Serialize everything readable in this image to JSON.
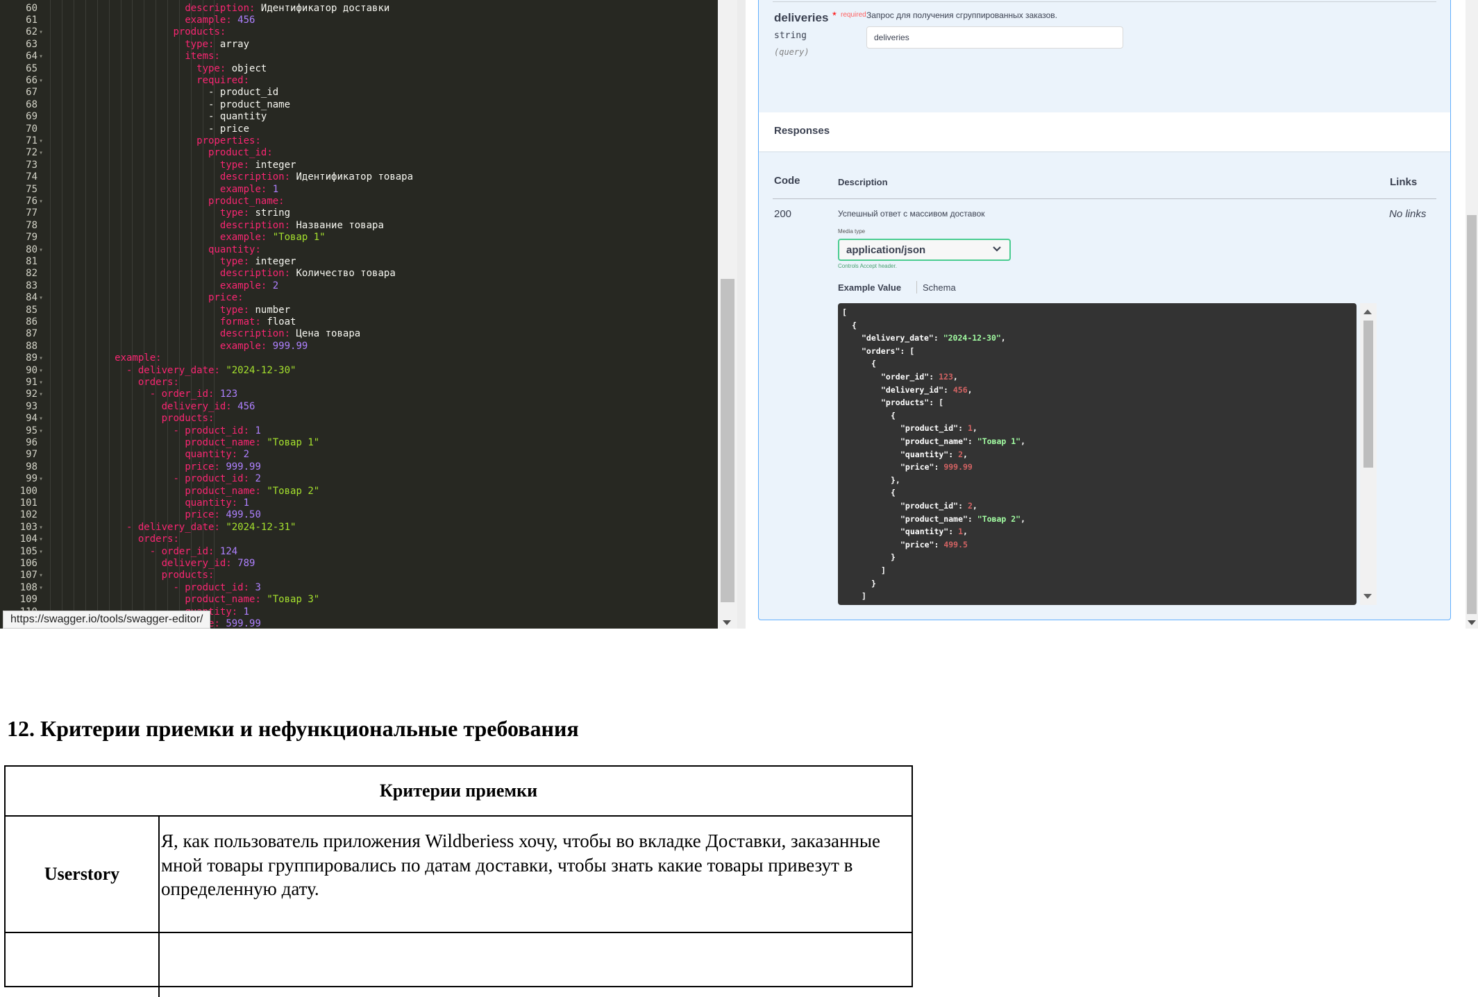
{
  "editor": {
    "first_line": 60,
    "lines": [
      [
        [
          12,
          "d",
          "description: "
        ],
        [
          0,
          "t",
          "Идентификатор доставки"
        ]
      ],
      [
        [
          12,
          "d",
          "example: "
        ],
        [
          0,
          "n",
          "456"
        ]
      ],
      [
        [
          11,
          "k",
          "products:"
        ]
      ],
      [
        [
          12,
          "d",
          "type: "
        ],
        [
          0,
          "t",
          "array"
        ]
      ],
      [
        [
          12,
          "k",
          "items:"
        ]
      ],
      [
        [
          13,
          "d",
          "type: "
        ],
        [
          0,
          "t",
          "object"
        ]
      ],
      [
        [
          13,
          "k",
          "required:"
        ]
      ],
      [
        [
          14,
          "t",
          "- product_id"
        ]
      ],
      [
        [
          14,
          "t",
          "- product_name"
        ]
      ],
      [
        [
          14,
          "t",
          "- quantity"
        ]
      ],
      [
        [
          14,
          "t",
          "- price"
        ]
      ],
      [
        [
          13,
          "k",
          "properties:"
        ]
      ],
      [
        [
          14,
          "k",
          "product_id:"
        ]
      ],
      [
        [
          15,
          "d",
          "type: "
        ],
        [
          0,
          "t",
          "integer"
        ]
      ],
      [
        [
          15,
          "d",
          "description: "
        ],
        [
          0,
          "t",
          "Идентификатор товара"
        ]
      ],
      [
        [
          15,
          "d",
          "example: "
        ],
        [
          0,
          "n",
          "1"
        ]
      ],
      [
        [
          14,
          "k",
          "product_name:"
        ]
      ],
      [
        [
          15,
          "d",
          "type: "
        ],
        [
          0,
          "t",
          "string"
        ]
      ],
      [
        [
          15,
          "d",
          "description: "
        ],
        [
          0,
          "t",
          "Название товара"
        ]
      ],
      [
        [
          15,
          "d",
          "example: "
        ],
        [
          0,
          "s",
          "\"Товар 1\""
        ]
      ],
      [
        [
          14,
          "k",
          "quantity:"
        ]
      ],
      [
        [
          15,
          "d",
          "type: "
        ],
        [
          0,
          "t",
          "integer"
        ]
      ],
      [
        [
          15,
          "d",
          "description: "
        ],
        [
          0,
          "t",
          "Количество товара"
        ]
      ],
      [
        [
          15,
          "d",
          "example: "
        ],
        [
          0,
          "n",
          "2"
        ]
      ],
      [
        [
          14,
          "k",
          "price:"
        ]
      ],
      [
        [
          15,
          "d",
          "type: "
        ],
        [
          0,
          "t",
          "number"
        ]
      ],
      [
        [
          15,
          "d",
          "format: "
        ],
        [
          0,
          "t",
          "float"
        ]
      ],
      [
        [
          15,
          "d",
          "description: "
        ],
        [
          0,
          "t",
          "Цена товара"
        ]
      ],
      [
        [
          15,
          "d",
          "example: "
        ],
        [
          0,
          "n",
          "999.99"
        ]
      ],
      [
        [
          6,
          "k",
          "example:"
        ]
      ],
      [
        [
          7,
          "k",
          "- delivery_date: "
        ],
        [
          0,
          "s",
          "\"2024-12-30\""
        ]
      ],
      [
        [
          8,
          "k",
          "orders:"
        ]
      ],
      [
        [
          9,
          "k",
          "- order_id: "
        ],
        [
          0,
          "n",
          "123"
        ]
      ],
      [
        [
          10,
          "k",
          "delivery_id: "
        ],
        [
          0,
          "n",
          "456"
        ]
      ],
      [
        [
          10,
          "k",
          "products:"
        ]
      ],
      [
        [
          11,
          "k",
          "- product_id: "
        ],
        [
          0,
          "n",
          "1"
        ]
      ],
      [
        [
          12,
          "k",
          "product_name: "
        ],
        [
          0,
          "s",
          "\"Товар 1\""
        ]
      ],
      [
        [
          12,
          "k",
          "quantity: "
        ],
        [
          0,
          "n",
          "2"
        ]
      ],
      [
        [
          12,
          "k",
          "price: "
        ],
        [
          0,
          "n",
          "999.99"
        ]
      ],
      [
        [
          11,
          "k",
          "- product_id: "
        ],
        [
          0,
          "n",
          "2"
        ]
      ],
      [
        [
          12,
          "k",
          "product_name: "
        ],
        [
          0,
          "s",
          "\"Товар 2\""
        ]
      ],
      [
        [
          12,
          "k",
          "quantity: "
        ],
        [
          0,
          "n",
          "1"
        ]
      ],
      [
        [
          12,
          "k",
          "price: "
        ],
        [
          0,
          "n",
          "499.50"
        ]
      ],
      [
        [
          7,
          "k",
          "- delivery_date: "
        ],
        [
          0,
          "s",
          "\"2024-12-31\""
        ]
      ],
      [
        [
          8,
          "k",
          "orders:"
        ]
      ],
      [
        [
          9,
          "k",
          "- order_id: "
        ],
        [
          0,
          "n",
          "124"
        ]
      ],
      [
        [
          10,
          "k",
          "delivery_id: "
        ],
        [
          0,
          "n",
          "789"
        ]
      ],
      [
        [
          10,
          "k",
          "products:"
        ]
      ],
      [
        [
          11,
          "k",
          "- product_id: "
        ],
        [
          0,
          "n",
          "3"
        ]
      ],
      [
        [
          12,
          "k",
          "product_name: "
        ],
        [
          0,
          "s",
          "\"Товар 3\""
        ]
      ],
      [
        [
          12,
          "k",
          "quantity: "
        ],
        [
          0,
          "n",
          "1"
        ]
      ],
      [
        [
          12,
          "k",
          "price: "
        ],
        [
          0,
          "n",
          "599.99"
        ]
      ]
    ],
    "fold_lines": [
      62,
      64,
      66,
      71,
      72,
      76,
      80,
      84,
      89,
      90,
      91,
      92,
      94,
      95,
      99,
      103,
      104,
      105,
      107,
      108
    ],
    "url_tooltip": "https://swagger.io/tools/swagger-editor/"
  },
  "swagger": {
    "param": {
      "name": "deliveries",
      "required_star": "*",
      "required_label": "required",
      "type": "string",
      "in": "(query)",
      "description": "Запрос для получения сгруппированных заказов.",
      "input_value": "deliveries"
    },
    "responses_title": "Responses",
    "headers": {
      "code": "Code",
      "description": "Description",
      "links": "Links"
    },
    "response": {
      "code": "200",
      "description": "Успешный ответ с массивом доставок",
      "links": "No links",
      "media_type_label": "Media type",
      "media_type": "application/json",
      "controls_hint": "Controls Accept header."
    },
    "tabs": {
      "example": "Example Value",
      "schema": "Schema"
    },
    "example_json": [
      [
        [
          0,
          "p",
          "["
        ]
      ],
      [
        [
          1,
          "p",
          "{"
        ]
      ],
      [
        [
          2,
          "k",
          "\"delivery_date\": "
        ],
        [
          0,
          "s",
          "\"2024-12-30\""
        ],
        [
          0,
          "p",
          ","
        ]
      ],
      [
        [
          2,
          "k",
          "\"orders\": ["
        ]
      ],
      [
        [
          3,
          "p",
          "{"
        ]
      ],
      [
        [
          4,
          "k",
          "\"order_id\": "
        ],
        [
          0,
          "n",
          "123"
        ],
        [
          0,
          "p",
          ","
        ]
      ],
      [
        [
          4,
          "k",
          "\"delivery_id\": "
        ],
        [
          0,
          "n",
          "456"
        ],
        [
          0,
          "p",
          ","
        ]
      ],
      [
        [
          4,
          "k",
          "\"products\": ["
        ]
      ],
      [
        [
          5,
          "p",
          "{"
        ]
      ],
      [
        [
          6,
          "k",
          "\"product_id\": "
        ],
        [
          0,
          "n",
          "1"
        ],
        [
          0,
          "p",
          ","
        ]
      ],
      [
        [
          6,
          "k",
          "\"product_name\": "
        ],
        [
          0,
          "s",
          "\"Товар 1\""
        ],
        [
          0,
          "p",
          ","
        ]
      ],
      [
        [
          6,
          "k",
          "\"quantity\": "
        ],
        [
          0,
          "n",
          "2"
        ],
        [
          0,
          "p",
          ","
        ]
      ],
      [
        [
          6,
          "k",
          "\"price\": "
        ],
        [
          0,
          "n",
          "999.99"
        ]
      ],
      [
        [
          5,
          "p",
          "},"
        ]
      ],
      [
        [
          5,
          "p",
          "{"
        ]
      ],
      [
        [
          6,
          "k",
          "\"product_id\": "
        ],
        [
          0,
          "n",
          "2"
        ],
        [
          0,
          "p",
          ","
        ]
      ],
      [
        [
          6,
          "k",
          "\"product_name\": "
        ],
        [
          0,
          "s",
          "\"Товар 2\""
        ],
        [
          0,
          "p",
          ","
        ]
      ],
      [
        [
          6,
          "k",
          "\"quantity\": "
        ],
        [
          0,
          "n",
          "1"
        ],
        [
          0,
          "p",
          ","
        ]
      ],
      [
        [
          6,
          "k",
          "\"price\": "
        ],
        [
          0,
          "n",
          "499.5"
        ]
      ],
      [
        [
          5,
          "p",
          "}"
        ]
      ],
      [
        [
          4,
          "p",
          "]"
        ]
      ],
      [
        [
          3,
          "p",
          "}"
        ]
      ],
      [
        [
          2,
          "p",
          "]"
        ]
      ]
    ]
  },
  "document": {
    "heading": "12. Критерии приемки и нефункциональные требования",
    "table_header": "Критерии приемки",
    "userstory_label": "Userstory",
    "userstory_text": "Я, как пользователь приложения Wildberiess хочу, чтобы во вкладке Доставки, заказанные мной товары группировались по датам доставки, чтобы знать какие товары привезут в определенную дату."
  }
}
